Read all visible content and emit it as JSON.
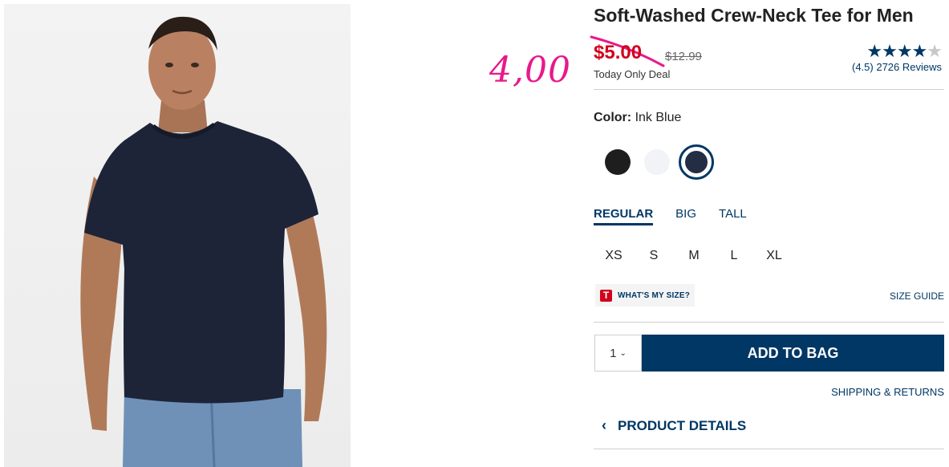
{
  "product": {
    "title": "Soft-Washed Crew-Neck Tee for Men",
    "sale_price": "$5.00",
    "original_price": "$12.99",
    "deal_label": "Today Only Deal",
    "rating": {
      "stars_full": "★★★★",
      "stars_partial": "★",
      "value": 4.5,
      "text": "(4.5) 2726 Reviews"
    }
  },
  "annotation": {
    "handwritten_price": "4,00",
    "color": "#e8198b"
  },
  "color": {
    "label": "Color:",
    "selected": "Ink Blue",
    "swatches": [
      {
        "name": "black",
        "hex": "#1e1e1e",
        "selected": false
      },
      {
        "name": "white",
        "hex": "#f2f3f6",
        "selected": false
      },
      {
        "name": "ink-blue",
        "hex": "#232d44",
        "selected": true
      }
    ]
  },
  "fit_tabs": [
    {
      "label": "REGULAR",
      "active": true
    },
    {
      "label": "BIG",
      "active": false
    },
    {
      "label": "TALL",
      "active": false
    }
  ],
  "sizes": [
    "XS",
    "S",
    "M",
    "L",
    "XL"
  ],
  "whats_my_size": {
    "badge": "T",
    "label": "WHAT'S MY SIZE?"
  },
  "size_guide": "SIZE GUIDE",
  "quantity": {
    "value": "1",
    "icon": "chevron-down-icon"
  },
  "add_to_bag": "ADD TO BAG",
  "shipping_returns": "SHIPPING & RETURNS",
  "product_details": {
    "label": "PRODUCT DETAILS",
    "icon": "chevron-left-icon"
  },
  "colors": {
    "accent": "#003764",
    "sale": "#d0021b"
  }
}
